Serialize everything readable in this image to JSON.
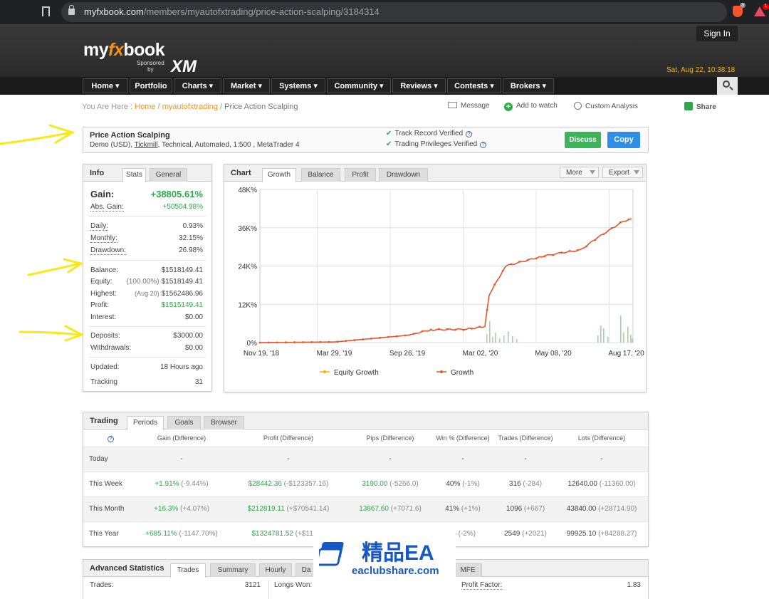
{
  "browser": {
    "url_host": "myfxbook.com",
    "url_path": "/members/myautofxtrading/price-action-scalping/3184314",
    "ext_badge_1": "3",
    "ext_badge_2": "1"
  },
  "header": {
    "logo_my": "my",
    "logo_fx": "fx",
    "logo_book": "book",
    "sponsored": "Sponsored",
    "by": "by",
    "sponsor": "XM",
    "signin": "Sign In",
    "datetime": "Sat, Aug 22, 10:38:18"
  },
  "nav": [
    "Home ▾",
    "Portfolio",
    "Charts ▾",
    "Market ▾",
    "Systems ▾",
    "Community ▾",
    "Reviews ▾",
    "Contests ▾",
    "Brokers ▾"
  ],
  "breadcrumb": {
    "prefix": "You Are Here : ",
    "home": "Home",
    "sep1": " / ",
    "user": "myautofxtrading",
    "sep2": " / ",
    "current": "Price Action Scalping"
  },
  "actions": {
    "message": "Message",
    "watch": "Add to watch",
    "custom": "Custom Analysis",
    "share": "Share"
  },
  "system": {
    "title": "Price Action Scalping",
    "sub_pre": "Demo (USD), ",
    "broker": "Tickmill",
    "sub_post": ", Technical, Automated, 1:500 , MetaTrader 4",
    "verified1": "Track Record Verified",
    "verified2": "Trading Privileges Verified",
    "discuss": "Discuss",
    "copy": "Copy"
  },
  "info": {
    "title": "Info",
    "tabs": [
      "Stats",
      "General"
    ],
    "gain_label": "Gain:",
    "gain_value": "+38805.61%",
    "abs_gain_label": "Abs. Gain:",
    "abs_gain_value": "+50504.98%",
    "daily_label": "Daily:",
    "daily_value": "0.93%",
    "monthly_label": "Monthly:",
    "monthly_value": "32.15%",
    "drawdown_label": "Drawdown:",
    "drawdown_value": "26.98%",
    "balance_label": "Balance:",
    "balance_value": "$1518149.41",
    "equity_label": "Equity:",
    "equity_sub": "(100.00%)",
    "equity_value": "$1518149.41",
    "highest_label": "Highest:",
    "highest_sub": "(Aug 20)",
    "highest_value": "$1562486.96",
    "profit_label": "Profit:",
    "profit_value": "$1515149.41",
    "interest_label": "Interest:",
    "interest_value": "$0.00",
    "deposits_label": "Deposits:",
    "deposits_value": "$3000.00",
    "withdrawals_label": "Withdrawals:",
    "withdrawals_value": "$0.00",
    "updated_label": "Updated:",
    "updated_value": "18 Hours ago",
    "tracking_label": "Tracking",
    "tracking_value": "31"
  },
  "chart_panel": {
    "title": "Chart",
    "tabs": [
      "Growth",
      "Balance",
      "Profit",
      "Drawdown"
    ],
    "more": "More",
    "export": "Export"
  },
  "chart_data": {
    "type": "line",
    "yticks": [
      "48K%",
      "36K%",
      "24K%",
      "12K%",
      "0%"
    ],
    "xticks": [
      "Nov 19, '18",
      "Mar 29, '19",
      "Sep 26, '19",
      "Mar 02, '20",
      "May 08, '20",
      "Aug 17, '20"
    ],
    "ylim": [
      0,
      48000
    ],
    "series": [
      {
        "name": "Equity Growth",
        "color": "#f7b500",
        "values": []
      },
      {
        "name": "Growth",
        "color": "#e8552b",
        "x": [
          "Nov 19, '18",
          "Mar 29, '19",
          "Sep 26, '19",
          "Oct 2019",
          "Dec 2019",
          "Mar 02, '20",
          "Mar 2020",
          "Apr 2020",
          "May 08, '20",
          "Jun 2020",
          "Jul 2020",
          "Aug 2020",
          "Aug 17, '20",
          "Aug 21, '20"
        ],
        "values": [
          0,
          200,
          2300,
          4000,
          4200,
          5000,
          15000,
          24000,
          27000,
          28000,
          29000,
          33000,
          38000,
          38805
        ]
      }
    ],
    "legend": [
      "Equity Growth",
      "Growth"
    ],
    "grid": true
  },
  "trading": {
    "title": "Trading",
    "tabs": [
      "Periods",
      "Goals",
      "Browser"
    ],
    "columns": [
      "Gain (Difference)",
      "Profit (Difference)",
      "Pips (Difference)",
      "Win % (Difference)",
      "Trades (Difference)",
      "Lots (Difference)"
    ],
    "rows": [
      {
        "label": "Today",
        "cells": [
          [
            "-",
            ""
          ],
          [
            "-",
            ""
          ],
          [
            "-",
            ""
          ],
          [
            "-",
            ""
          ],
          [
            "-",
            ""
          ],
          [
            "-",
            ""
          ]
        ]
      },
      {
        "label": "This Week",
        "cells": [
          [
            "+1.91%",
            "(-9.44%)"
          ],
          [
            "$28442.36",
            "(-$123357.16)"
          ],
          [
            "3190.00",
            "(-5266.0)"
          ],
          [
            "40%",
            "(-1%)"
          ],
          [
            "316",
            "(-284)"
          ],
          [
            "12640.00",
            "(-11360.00)"
          ]
        ]
      },
      {
        "label": "This Month",
        "cells": [
          [
            "+16.3%",
            "(+4.07%)"
          ],
          [
            "$212819.11",
            "(+$70541.14)"
          ],
          [
            "13867.60",
            "(+7071.6)"
          ],
          [
            "41%",
            "(+1%)"
          ],
          [
            "1096",
            "(+667)"
          ],
          [
            "43840.00",
            "(+28714.90)"
          ]
        ]
      },
      {
        "label": "This Year",
        "cells": [
          [
            "+685.11%",
            "(-1147.70%)"
          ],
          [
            "$1324781.52",
            "(+$11391"
          ],
          [
            "",
            ""
          ],
          [
            "%",
            "(-2%)"
          ],
          [
            "2549",
            "(+2021)"
          ],
          [
            "99925.10",
            "(+84288.27)"
          ]
        ]
      }
    ]
  },
  "advanced": {
    "title": "Advanced Statistics",
    "tabs": [
      "Trades",
      "Summary",
      "Hourly",
      "Da",
      "MFE"
    ],
    "trades_label": "Trades:",
    "trades_value": "3121",
    "longs_label": "Longs Won:",
    "pf_label": "Profit Factor:",
    "pf_value": "1.83"
  },
  "watermark": {
    "cn": "精品EA",
    "url": "eaclubshare.com"
  }
}
